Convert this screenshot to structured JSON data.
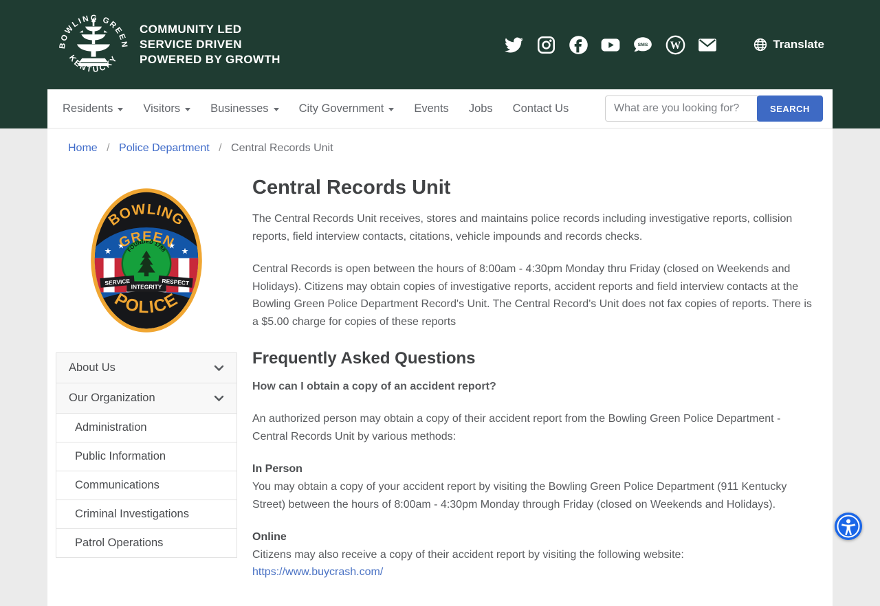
{
  "theme": {
    "header_green": "#1f3c32",
    "search_button_blue": "#3e6ac4",
    "link_blue": "#3f6bc9",
    "accessibility_blue": "#1a66e8",
    "badge_gold": "#f0a632",
    "badge_blue": "#1356a8",
    "badge_red": "#c8293a",
    "badge_green": "#15a03c"
  },
  "header": {
    "logo": {
      "top_text": "BOWLING GREEN",
      "bottom_text": "KENTUCKY",
      "icon": "fountain-icon"
    },
    "tagline_lines": [
      "COMMUNITY LED",
      "SERVICE DRIVEN",
      "POWERED BY GROWTH"
    ],
    "social": [
      {
        "name": "twitter"
      },
      {
        "name": "instagram"
      },
      {
        "name": "facebook"
      },
      {
        "name": "youtube"
      },
      {
        "name": "sms"
      },
      {
        "name": "wordpress"
      },
      {
        "name": "email"
      }
    ],
    "translate_label": "Translate"
  },
  "nav": {
    "items": [
      {
        "label": "Residents",
        "dropdown": true
      },
      {
        "label": "Visitors",
        "dropdown": true
      },
      {
        "label": "Businesses",
        "dropdown": true
      },
      {
        "label": "City Government",
        "dropdown": true
      },
      {
        "label": "Events",
        "dropdown": false
      },
      {
        "label": "Jobs",
        "dropdown": false
      },
      {
        "label": "Contact Us",
        "dropdown": false
      }
    ],
    "search": {
      "placeholder": "What are you looking for?",
      "button_label": "SEARCH"
    }
  },
  "breadcrumb": {
    "separator": "/",
    "items": [
      {
        "label": "Home",
        "link": true
      },
      {
        "label": "Police Department",
        "link": true
      },
      {
        "label": "Central Records Unit",
        "link": false
      }
    ]
  },
  "badge": {
    "top_line1": "BOWLING",
    "top_line2": "GREEN",
    "founded": "FOUNDED 1798",
    "banner_left": "SERVICE",
    "banner_center": "INTEGRITY",
    "banner_right": "RESPECT",
    "bottom": "POLICE"
  },
  "sidebar": {
    "menu": [
      {
        "label": "About Us",
        "type": "header"
      },
      {
        "label": "Our Organization",
        "type": "header"
      },
      {
        "label": "Administration",
        "type": "sub"
      },
      {
        "label": "Public Information",
        "type": "sub"
      },
      {
        "label": "Communications",
        "type": "sub"
      },
      {
        "label": "Criminal Investigations",
        "type": "sub"
      },
      {
        "label": "Patrol Operations",
        "type": "sub"
      }
    ]
  },
  "main": {
    "title": "Central Records Unit",
    "intro_p1": "The Central Records Unit receives, stores and maintains police records including investigative reports, collision reports, field interview contacts, citations, vehicle impounds and records checks.",
    "intro_p2": "Central Records is open between the hours of 8:00am - 4:30pm Monday thru Friday (closed on Weekends and Holidays). Citizens may obtain copies of investigative reports, accident reports and field interview contacts at the Bowling Green Police Department Record's Unit. The Central Record's Unit does not fax copies of reports. There is a $5.00 charge for copies of these reports",
    "faq_title": "Frequently Asked Questions",
    "faq_question": "How can I obtain a copy of an accident report?",
    "faq_answer": "An authorized person may obtain a copy of their accident report from the Bowling Green Police Department - Central Records Unit by various methods:",
    "in_person_label": "In Person",
    "in_person_text": "You may obtain a copy of your accident report by visiting the Bowling Green Police Department (911 Kentucky Street) between the hours of 8:00am - 4:30pm Monday through Friday (closed on Weekends and Holidays).",
    "online_label": "Online",
    "online_text": "Citizens may also receive a copy of their accident report by visiting the following website:",
    "online_link": "https://www.buycrash.com/"
  }
}
